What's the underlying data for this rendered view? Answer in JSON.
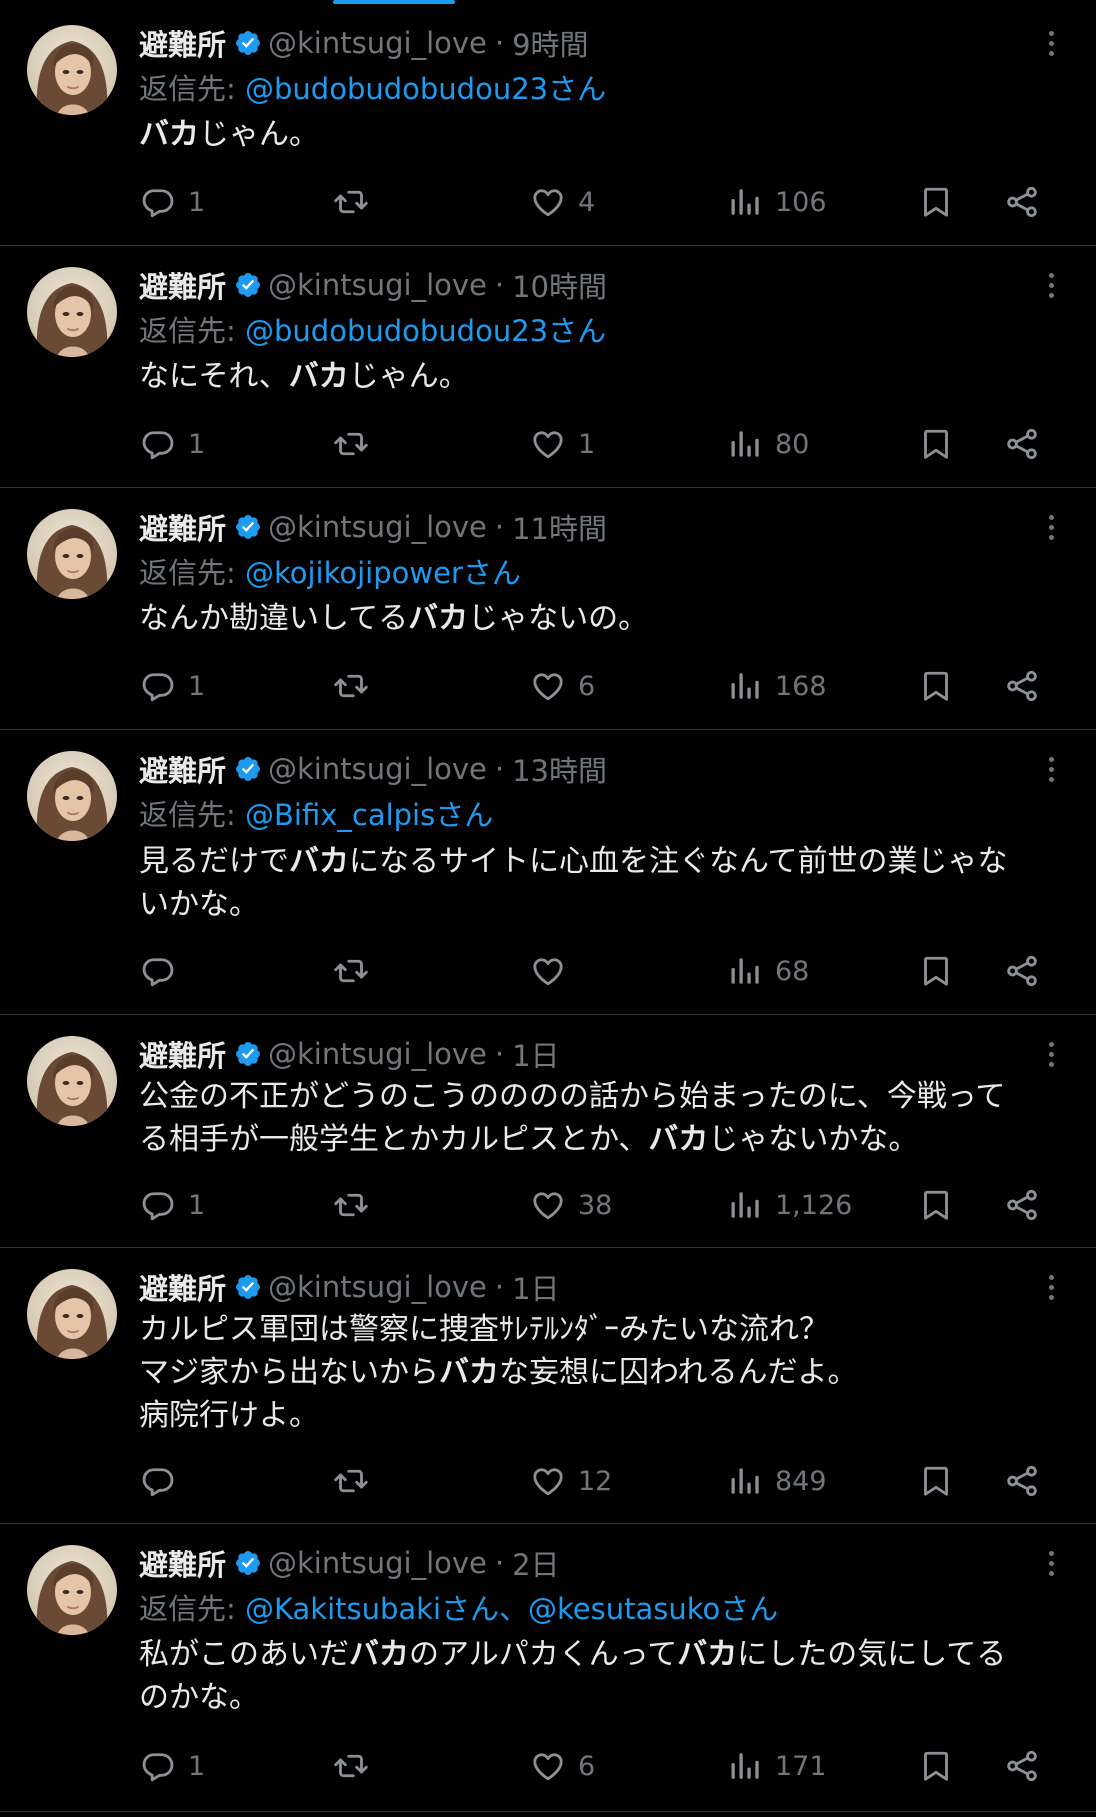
{
  "tweets": [
    {
      "name": "避難所",
      "handle": "@kintsugi_love",
      "separator": "·",
      "time": "9時間",
      "reply_prefix": "返信先: ",
      "reply_to": "@budobudobudou23さん",
      "body_lines": [
        [
          {
            "t": "バカ",
            "b": true
          },
          {
            "t": "じゃん。"
          }
        ]
      ],
      "replies": "1",
      "retweets": "",
      "likes": "4",
      "views": "106"
    },
    {
      "name": "避難所",
      "handle": "@kintsugi_love",
      "separator": "·",
      "time": "10時間",
      "reply_prefix": "返信先: ",
      "reply_to": "@budobudobudou23さん",
      "body_lines": [
        [
          {
            "t": "なにそれ、"
          },
          {
            "t": "バカ",
            "b": true
          },
          {
            "t": "じゃん。"
          }
        ]
      ],
      "replies": "1",
      "retweets": "",
      "likes": "1",
      "views": "80"
    },
    {
      "name": "避難所",
      "handle": "@kintsugi_love",
      "separator": "·",
      "time": "11時間",
      "reply_prefix": "返信先: ",
      "reply_to": "@kojikojipowerさん",
      "body_lines": [
        [
          {
            "t": "なんか勘違いしてる"
          },
          {
            "t": "バカ",
            "b": true
          },
          {
            "t": "じゃないの。"
          }
        ]
      ],
      "replies": "1",
      "retweets": "",
      "likes": "6",
      "views": "168"
    },
    {
      "name": "避難所",
      "handle": "@kintsugi_love",
      "separator": "·",
      "time": "13時間",
      "reply_prefix": "返信先: ",
      "reply_to": "@Bifix_calpisさん",
      "body_lines": [
        [
          {
            "t": "見るだけで"
          },
          {
            "t": "バカ",
            "b": true
          },
          {
            "t": "になるサイトに心血を注ぐなんて前世の業じゃな"
          }
        ],
        [
          {
            "t": "いかな。"
          }
        ]
      ],
      "replies": "",
      "retweets": "",
      "likes": "",
      "views": "68"
    },
    {
      "name": "避難所",
      "handle": "@kintsugi_love",
      "separator": "·",
      "time": "1日",
      "reply_prefix": "",
      "reply_to": "",
      "body_lines": [
        [
          {
            "t": "公金の不正がどうのこうのののの話から始まったのに、今戦って"
          }
        ],
        [
          {
            "t": "る相手が一般学生とかカルピスとか、"
          },
          {
            "t": "バカ",
            "b": true
          },
          {
            "t": "じゃないかな。"
          }
        ]
      ],
      "replies": "1",
      "retweets": "",
      "likes": "38",
      "views": "1,126"
    },
    {
      "name": "避難所",
      "handle": "@kintsugi_love",
      "separator": "·",
      "time": "1日",
      "reply_prefix": "",
      "reply_to": "",
      "body_lines": [
        [
          {
            "t": "カルピス軍団は警察に捜査ｻﾚﾃﾙﾝﾀﾞｰみたいな流れ？"
          }
        ],
        [
          {
            "t": "マジ家から出ないから"
          },
          {
            "t": "バカ",
            "b": true
          },
          {
            "t": "な妄想に囚われるんだよ。"
          }
        ],
        [
          {
            "t": "病院行けよ。"
          }
        ]
      ],
      "replies": "",
      "retweets": "",
      "likes": "12",
      "views": "849"
    },
    {
      "name": "避難所",
      "handle": "@kintsugi_love",
      "separator": "·",
      "time": "2日",
      "reply_prefix": "返信先: ",
      "reply_to": "@Kakitsubakiさん、@kesutasukoさん",
      "body_lines": [
        [
          {
            "t": "私がこのあいだ"
          },
          {
            "t": "バカ",
            "b": true
          },
          {
            "t": "のアルパカくんって"
          },
          {
            "t": "バカ",
            "b": true
          },
          {
            "t": "にしたの気にしてる"
          }
        ],
        [
          {
            "t": "のかな。"
          }
        ]
      ],
      "replies": "1",
      "retweets": "",
      "likes": "6",
      "views": "171"
    }
  ],
  "colors": {
    "accent": "#1d9bf0",
    "muted": "#71767b",
    "text": "#e7e9ea",
    "background": "#000000",
    "divider": "#2f3336"
  },
  "icons": [
    "avatar",
    "verified-badge-icon",
    "more-icon",
    "reply-icon",
    "retweet-icon",
    "like-icon",
    "views-icon",
    "bookmark-icon",
    "share-icon"
  ]
}
